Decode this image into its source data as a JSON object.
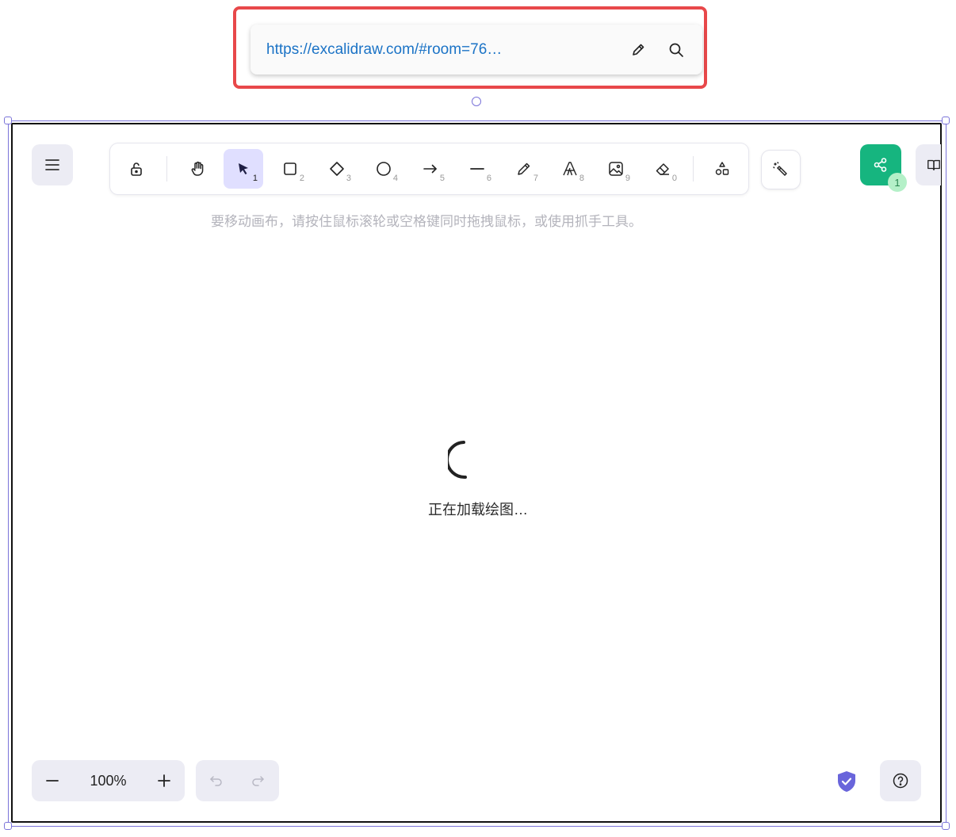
{
  "url_bar": {
    "url": "https://excalidraw.com/#room=76…",
    "edit_icon": "pencil-icon",
    "search_icon": "search-icon"
  },
  "toolbar": {
    "tools": [
      {
        "name": "lock",
        "icon": "lock-open-icon",
        "key": ""
      },
      {
        "name": "hand",
        "icon": "hand-icon",
        "key": ""
      },
      {
        "name": "selection",
        "icon": "pointer-icon",
        "key": "1",
        "active": true
      },
      {
        "name": "rectangle",
        "icon": "square-icon",
        "key": "2"
      },
      {
        "name": "diamond",
        "icon": "diamond-icon",
        "key": "3"
      },
      {
        "name": "ellipse",
        "icon": "circle-icon",
        "key": "4"
      },
      {
        "name": "arrow",
        "icon": "arrow-right-icon",
        "key": "5"
      },
      {
        "name": "line",
        "icon": "line-icon",
        "key": "6"
      },
      {
        "name": "draw",
        "icon": "pencil-icon",
        "key": "7"
      },
      {
        "name": "text",
        "icon": "text-icon",
        "key": "8"
      },
      {
        "name": "image",
        "icon": "image-icon",
        "key": "9"
      },
      {
        "name": "eraser",
        "icon": "eraser-icon",
        "key": "0"
      },
      {
        "name": "more-tools",
        "icon": "shapes-icon",
        "key": ""
      }
    ]
  },
  "hint_text": "要移动画布，请按住鼠标滚轮或空格键同时拖拽鼠标，或使用抓手工具。",
  "loading_text": "正在加载绘图…",
  "share": {
    "collaborators_count": "1"
  },
  "zoom": {
    "level": "100%",
    "minus": "−",
    "plus": "+"
  },
  "colors": {
    "accent": "#6965db",
    "active_tool_bg": "#e0dfff",
    "share_green": "#16b57f",
    "highlight_red": "#e8484a",
    "url_blue": "#1b73c6"
  }
}
